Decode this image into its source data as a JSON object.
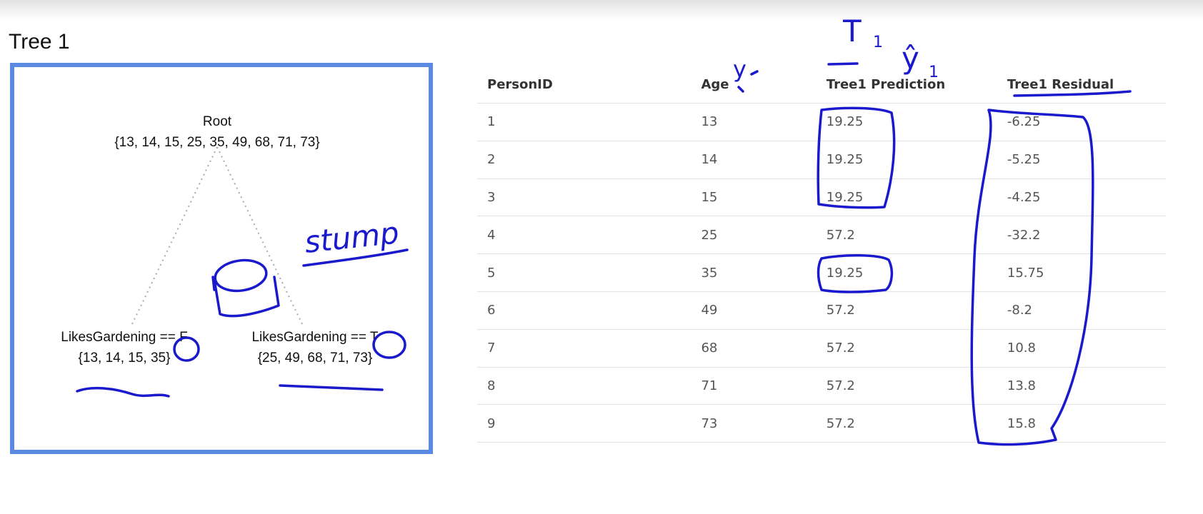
{
  "tree": {
    "title": "Tree 1",
    "root": {
      "label": "Root",
      "values": "{13, 14, 15, 25, 35, 49, 68, 71, 73}"
    },
    "left_leaf": {
      "label": "LikesGardening == F",
      "values": "{13, 14, 15, 35}"
    },
    "right_leaf": {
      "label": "LikesGardening == T",
      "values": "{25, 49, 68, 71, 73}"
    }
  },
  "table": {
    "headers": [
      "PersonID",
      "Age",
      "Tree1 Prediction",
      "Tree1 Residual"
    ],
    "rows": [
      [
        "1",
        "13",
        "19.25",
        "-6.25"
      ],
      [
        "2",
        "14",
        "19.25",
        "-5.25"
      ],
      [
        "3",
        "15",
        "19.25",
        "-4.25"
      ],
      [
        "4",
        "25",
        "57.2",
        "-32.2"
      ],
      [
        "5",
        "35",
        "19.25",
        "15.75"
      ],
      [
        "6",
        "49",
        "57.2",
        "-8.2"
      ],
      [
        "7",
        "68",
        "57.2",
        "10.8"
      ],
      [
        "8",
        "71",
        "57.2",
        "13.8"
      ],
      [
        "9",
        "73",
        "57.2",
        "15.8"
      ]
    ]
  },
  "annotations": {
    "stump": "stump",
    "y_i": "y",
    "t1": "T",
    "t1_sub": "1",
    "yhat": "ŷ",
    "yhat_sub": "1",
    "ink_color": "#1a1acc"
  },
  "colors": {
    "panel_border": "#5b8be0",
    "edge": "#aaaaaa"
  }
}
